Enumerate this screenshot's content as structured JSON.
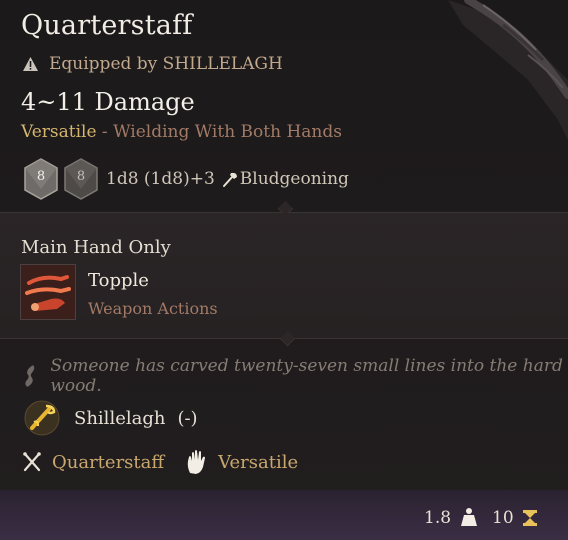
{
  "item": {
    "name": "Quarterstaff",
    "equipped_text": "Equipped by SHILLELAGH",
    "damage": "4~11 Damage",
    "property_label": "Versatile",
    "property_separator": " - ",
    "property_detail": "Wielding With Both Hands",
    "dice": [
      "8",
      "8"
    ],
    "damage_formula": "1d8 (1d8)+3",
    "damage_type": "Bludgeoning"
  },
  "action_section": {
    "hand_label": "Main Hand Only",
    "action_name": "Topple",
    "action_subtitle": "Weapon Actions"
  },
  "flavor": {
    "text": "Someone has carved twenty-seven small lines into the hard wood."
  },
  "spell": {
    "name": "Shillelagh",
    "paren": "(-)"
  },
  "proficiency": {
    "weapon": "Quarterstaff",
    "property": "Versatile"
  },
  "footer": {
    "weight": "1.8",
    "value": "10"
  },
  "icons": [
    "warning-icon",
    "d8-die-icon",
    "club-icon",
    "topple-action-icon",
    "quote-icon",
    "shillelagh-spell-icon",
    "crossed-weapons-icon",
    "hand-icon",
    "weight-icon",
    "gold-coin-icon"
  ],
  "colors": {
    "gold": "#d6b56e",
    "muted_copper": "#a27a66",
    "equip_text": "#c2a98d",
    "footer_purple": "#3b2e45"
  }
}
